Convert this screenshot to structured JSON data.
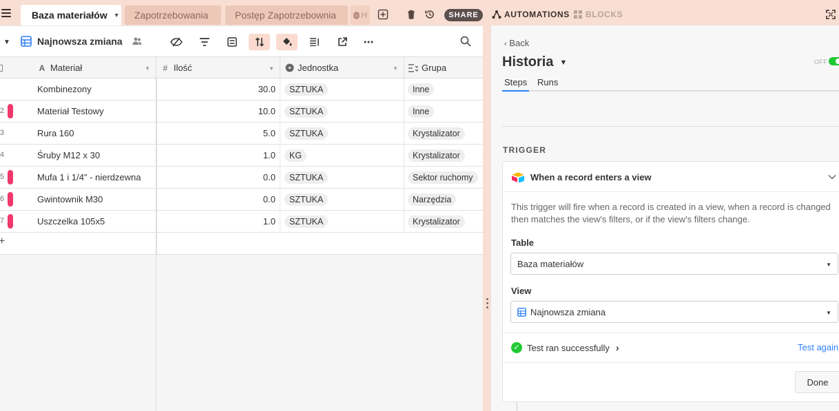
{
  "topbar": {
    "tabs": [
      {
        "label": "Baza materiałów",
        "active": true
      },
      {
        "label": "Zapotrzebowania",
        "active": false
      },
      {
        "label": "Postęp Zapotrzebownia",
        "active": false
      }
    ],
    "share_label": "SHARE",
    "automations_label": "AUTOMATIONS",
    "blocks_label": "BLOCKS"
  },
  "view": {
    "name": "Najnowsza zmiana",
    "icons": [
      "hide-fields-icon",
      "filter-icon",
      "group-icon",
      "sort-icon",
      "color-icon",
      "row-height-icon",
      "share-view-icon",
      "more-icon",
      "search-icon"
    ]
  },
  "columns": [
    {
      "label": "Materiał",
      "icon": "text-field-icon"
    },
    {
      "label": "Ilość",
      "icon": "number-field-icon"
    },
    {
      "label": "Jednostka",
      "icon": "single-select-icon"
    },
    {
      "label": "Grupa",
      "icon": "multi-select-icon"
    }
  ],
  "rows": [
    {
      "num": "",
      "flag": false,
      "material": "Kombinezony",
      "ilosc": "30.0",
      "jednostka": "SZTUKA",
      "grupa": "Inne"
    },
    {
      "num": "2",
      "flag": true,
      "material": "Materiał Testowy",
      "ilosc": "10.0",
      "jednostka": "SZTUKA",
      "grupa": "Inne"
    },
    {
      "num": "3",
      "flag": false,
      "material": "Rura 160",
      "ilosc": "5.0",
      "jednostka": "SZTUKA",
      "grupa": "Krystalizator"
    },
    {
      "num": "4",
      "flag": false,
      "material": "Śruby M12 x 30",
      "ilosc": "1.0",
      "jednostka": "KG",
      "grupa": "Krystalizator"
    },
    {
      "num": "5",
      "flag": true,
      "material": "Mufa 1 i 1/4\" - nierdzewna",
      "ilosc": "0.0",
      "jednostka": "SZTUKA",
      "grupa": "Sektor ruchomy"
    },
    {
      "num": "6",
      "flag": true,
      "material": "Gwintownik M30",
      "ilosc": "0.0",
      "jednostka": "SZTUKA",
      "grupa": "Narzędzia"
    },
    {
      "num": "7",
      "flag": true,
      "material": "Uszczelka 105x5",
      "ilosc": "1.0",
      "jednostka": "SZTUKA",
      "grupa": "Krystalizator"
    }
  ],
  "add_row": "+",
  "colors": {
    "accent": "#2d7ff9",
    "flag": "#f2386a",
    "success": "#20c933",
    "topbar": "#f8ded3"
  },
  "panel": {
    "back_label": "Back",
    "title": "Historia",
    "toggle_label": "OFF",
    "tabs": [
      "Steps",
      "Runs"
    ],
    "trigger_heading": "TRIGGER",
    "trigger_title": "When a record enters a view",
    "trigger_desc": "This trigger will fire when a record is created in a view, when a record is changed then matches the view's filters, or if the view's filters change.",
    "table_label": "Table",
    "table_value": "Baza materiałów",
    "view_label": "View",
    "view_value": "Najnowsza zmiana",
    "test_status": "Test ran successfully",
    "test_again": "Test again",
    "done_label": "Done"
  }
}
